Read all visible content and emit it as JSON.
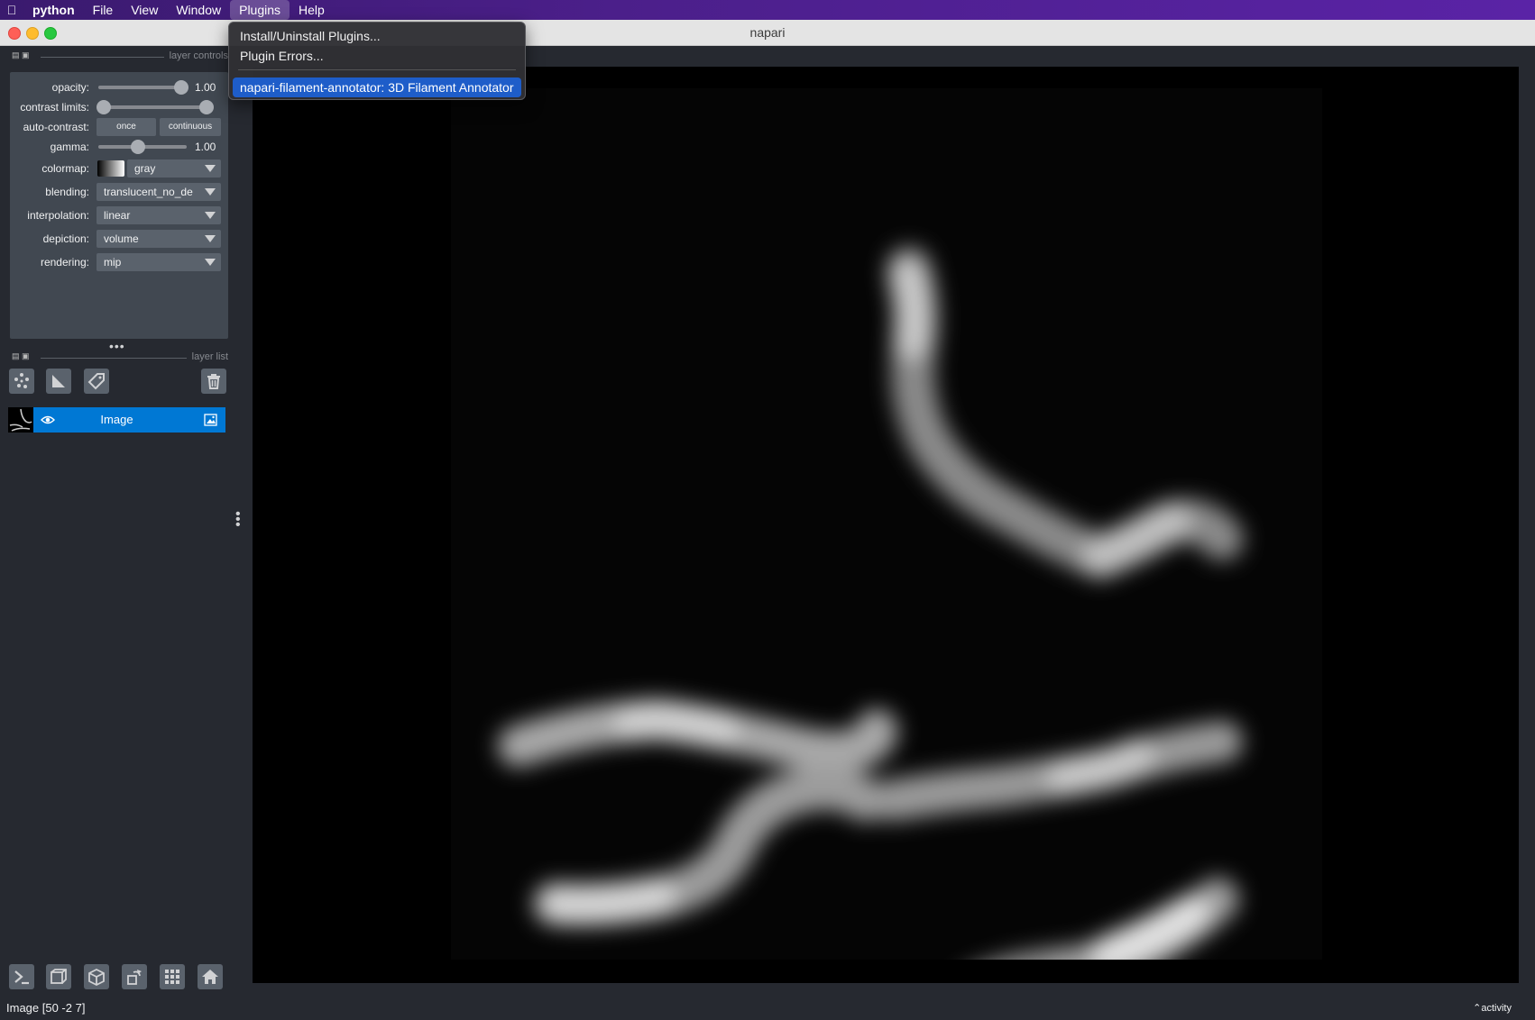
{
  "menubar": {
    "app": "python",
    "items": [
      "File",
      "View",
      "Window",
      "Plugins",
      "Help"
    ]
  },
  "window": {
    "title": "napari"
  },
  "layer_controls": {
    "title": "layer controls",
    "opacity": {
      "label": "opacity:",
      "value": "1.00",
      "fraction": 1.0
    },
    "contrast_limits": {
      "label": "contrast limits:",
      "range": [
        0.0,
        1.0
      ]
    },
    "auto_contrast": {
      "label": "auto-contrast:",
      "once": "once",
      "continuous": "continuous"
    },
    "gamma": {
      "label": "gamma:",
      "value": "1.00",
      "fraction": 0.45
    },
    "colormap": {
      "label": "colormap:",
      "value": "gray"
    },
    "blending": {
      "label": "blending:",
      "value": "translucent_no_de"
    },
    "interpolation": {
      "label": "interpolation:",
      "value": "linear"
    },
    "depiction": {
      "label": "depiction:",
      "value": "volume"
    },
    "rendering": {
      "label": "rendering:",
      "value": "mip"
    }
  },
  "layer_list": {
    "title": "layer list",
    "layers": [
      {
        "name": "Image",
        "visible": true
      }
    ]
  },
  "plugins_menu": {
    "items": [
      "Install/Uninstall Plugins...",
      "Plugin Errors...",
      "napari-filament-annotator: 3D Filament Annotator"
    ],
    "highlighted_index": 2
  },
  "status": {
    "text": "Image [50 -2  7]",
    "activity": "activity"
  },
  "colors": {
    "accent": "#0078d4",
    "menu_highlight": "#1e5dc9",
    "panel": "#414851",
    "background": "#262930"
  }
}
